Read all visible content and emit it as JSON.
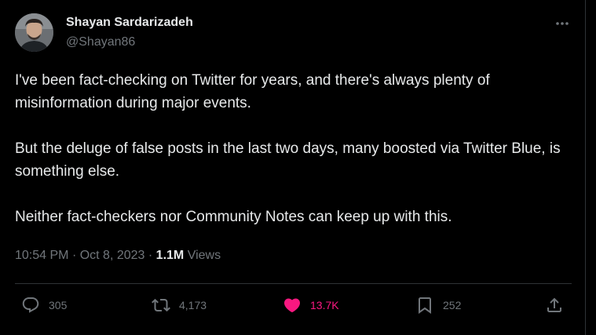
{
  "author": {
    "name": "Shayan Sardarizadeh",
    "handle": "@Shayan86"
  },
  "tweet": {
    "paragraphs": [
      "I've been fact-checking on Twitter for years, and there's always plenty of misinformation during major events.",
      "But the deluge of false posts in the last two days, many boosted via Twitter Blue, is something else.",
      "Neither fact-checkers nor Community Notes can keep up with this."
    ],
    "time": "10:54 PM",
    "separator": "·",
    "date": "Oct 8, 2023",
    "views_count": "1.1M",
    "views_label": "Views"
  },
  "actions": {
    "replies": "305",
    "retweets": "4,173",
    "likes": "13.7K",
    "bookmarks": "252"
  },
  "colors": {
    "background": "#000000",
    "text": "#e7e9ea",
    "secondary": "#71767b",
    "like_active": "#f91880",
    "border": "#2f3336"
  },
  "icons": [
    "more-icon",
    "reply-icon",
    "retweet-icon",
    "heart-icon",
    "bookmark-icon",
    "share-icon"
  ]
}
